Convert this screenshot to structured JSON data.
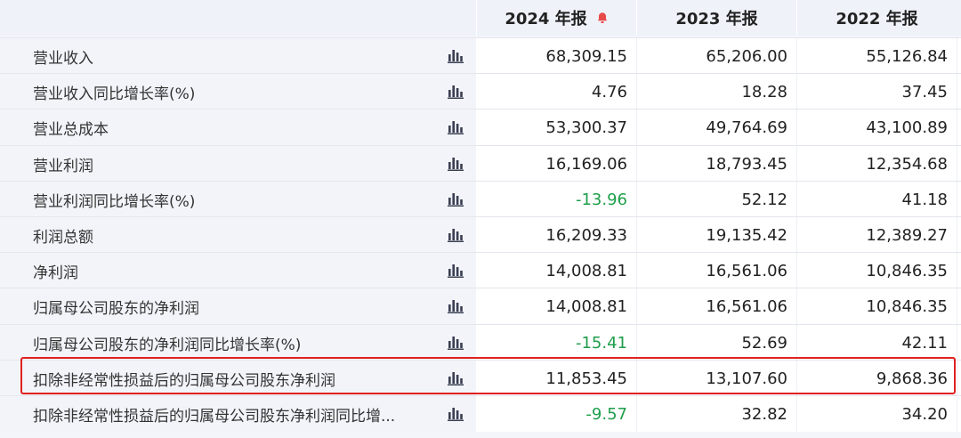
{
  "header": {
    "columns": [
      "2024 年报",
      "2023 年报",
      "2022 年报"
    ],
    "alert_icon": "bell-icon",
    "accent_color": "#e84a4a"
  },
  "rows": [
    {
      "label": "营业收入",
      "v2024": "68,309.15",
      "v2023": "65,206.00",
      "v2022": "55,126.84"
    },
    {
      "label": "营业收入同比增长率(%)",
      "v2024": "4.76",
      "v2023": "18.28",
      "v2022": "37.45"
    },
    {
      "label": "营业总成本",
      "v2024": "53,300.37",
      "v2023": "49,764.69",
      "v2022": "43,100.89"
    },
    {
      "label": "营业利润",
      "v2024": "16,169.06",
      "v2023": "18,793.45",
      "v2022": "12,354.68"
    },
    {
      "label": "营业利润同比增长率(%)",
      "v2024": "-13.96",
      "v2023": "52.12",
      "v2022": "41.18",
      "neg2024": true
    },
    {
      "label": "利润总额",
      "v2024": "16,209.33",
      "v2023": "19,135.42",
      "v2022": "12,389.27"
    },
    {
      "label": "净利润",
      "v2024": "14,008.81",
      "v2023": "16,561.06",
      "v2022": "10,846.35"
    },
    {
      "label": "归属母公司股东的净利润",
      "v2024": "14,008.81",
      "v2023": "16,561.06",
      "v2022": "10,846.35"
    },
    {
      "label": "归属母公司股东的净利润同比增长率(%)",
      "v2024": "-15.41",
      "v2023": "52.69",
      "v2022": "42.11",
      "neg2024": true
    },
    {
      "label": "扣除非经常性损益后的归属母公司股东净利润",
      "v2024": "11,853.45",
      "v2023": "13,107.60",
      "v2022": "9,868.36",
      "highlighted": true
    },
    {
      "label": "扣除非经常性损益后的归属母公司股东净利润同比增...",
      "v2024": "-9.57",
      "v2023": "32.82",
      "v2022": "34.20",
      "neg2024": true
    }
  ],
  "colors": {
    "negative": "#1f9e4a",
    "highlight_border": "#e02020",
    "icon": "#3a3f52"
  }
}
